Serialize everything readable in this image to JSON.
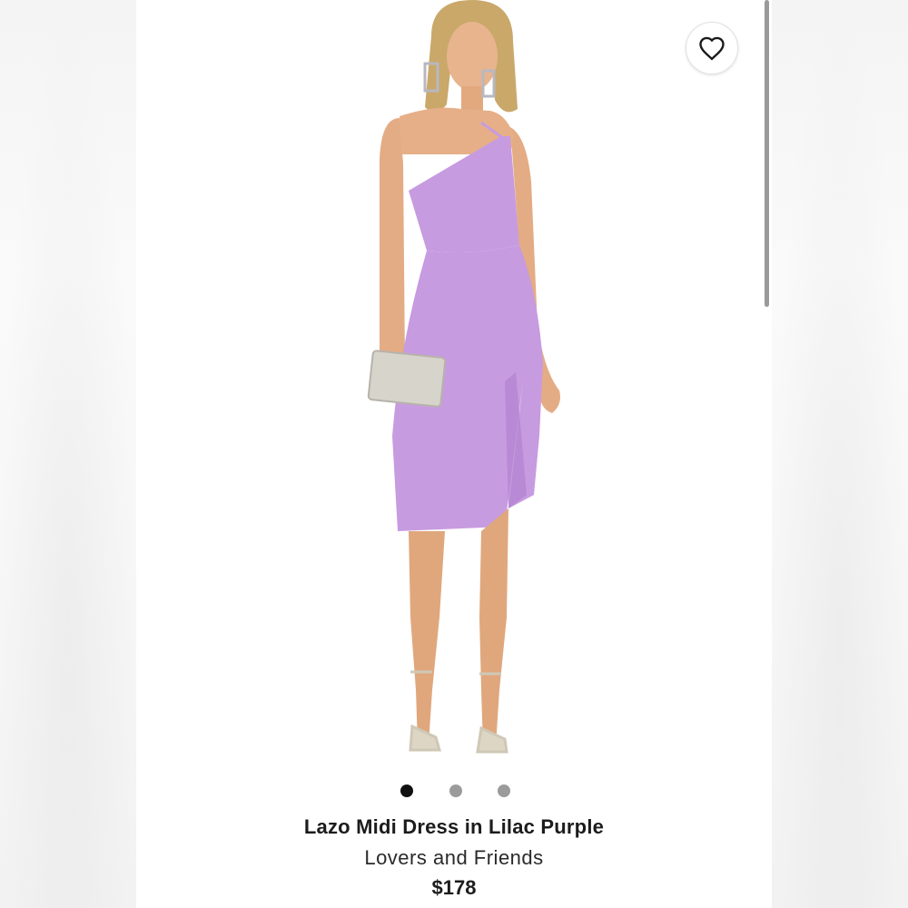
{
  "product": {
    "name": "Lazo Midi Dress in Lilac Purple",
    "brand": "Lovers and Friends",
    "price": "$178",
    "image_alt": "Model wearing lilac one-shoulder midi dress with side slit, holding a silver clutch",
    "dress_color": "#c79be0"
  },
  "carousel": {
    "total": 3,
    "active_index": 1
  },
  "icons": {
    "favorite": "heart-outline-icon"
  }
}
